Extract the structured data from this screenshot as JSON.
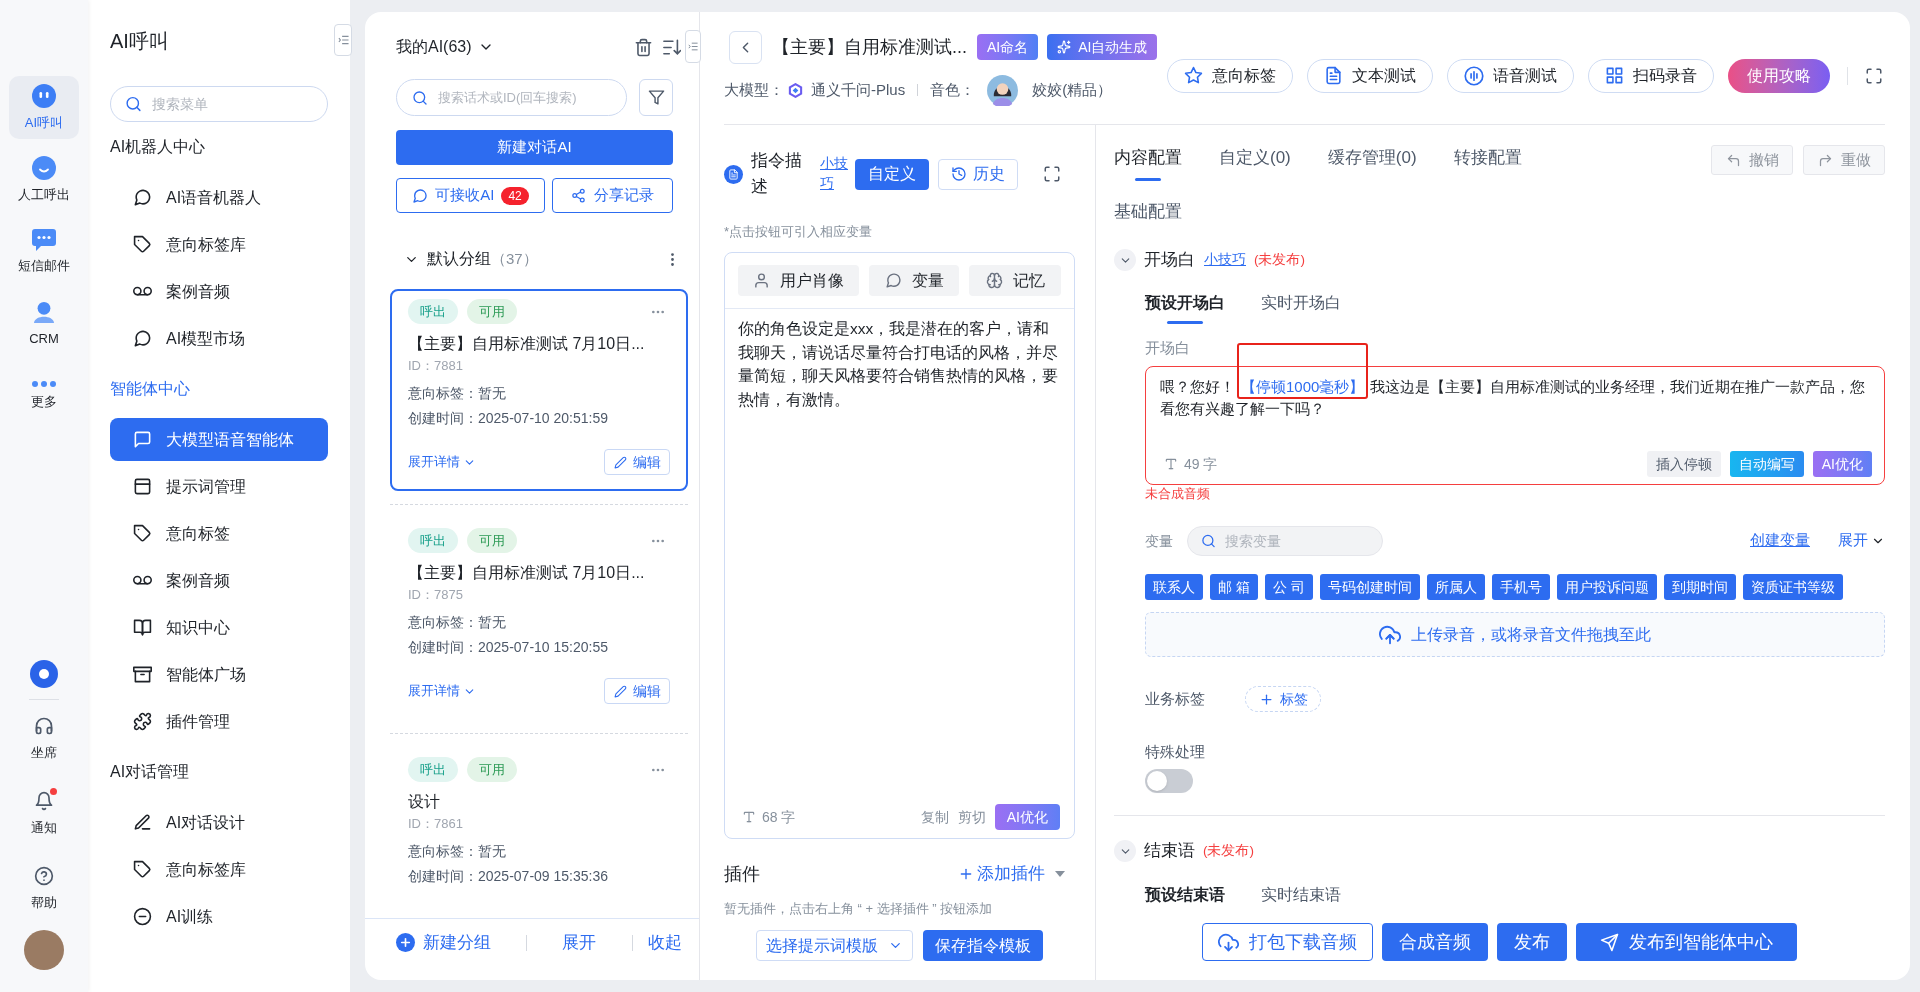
{
  "rail": {
    "items": [
      {
        "label": "AI呼叫",
        "selected": true
      },
      {
        "label": "人工呼出",
        "selected": false
      },
      {
        "label": "短信邮件",
        "selected": false
      },
      {
        "label": "CRM",
        "selected": false
      },
      {
        "label": "更多",
        "selected": false
      }
    ],
    "tools": [
      {
        "label": "坐席",
        "badge": false
      },
      {
        "label": "通知",
        "badge": true
      },
      {
        "label": "帮助",
        "badge": false
      }
    ]
  },
  "sidebar": {
    "title": "AI呼叫",
    "search": {
      "placeholder": "搜索菜单"
    },
    "sections": [
      {
        "heading": "AI机器人中心",
        "active": false,
        "items": [
          {
            "label": "AI语音机器人",
            "selected": false
          },
          {
            "label": "意向标签库",
            "selected": false
          },
          {
            "label": "案例音频",
            "selected": false
          },
          {
            "label": "AI模型市场",
            "selected": false
          }
        ]
      },
      {
        "heading": "智能体中心",
        "active": true,
        "items": [
          {
            "label": "大模型语音智能体",
            "selected": true
          },
          {
            "label": "提示词管理",
            "selected": false
          },
          {
            "label": "意向标签",
            "selected": false
          },
          {
            "label": "案例音频",
            "selected": false
          },
          {
            "label": "知识中心",
            "selected": false
          },
          {
            "label": "智能体广场",
            "selected": false
          },
          {
            "label": "插件管理",
            "selected": false
          }
        ]
      },
      {
        "heading": "AI对话管理",
        "active": false,
        "items": [
          {
            "label": "AI对话设计",
            "selected": false
          },
          {
            "label": "意向标签库",
            "selected": false
          },
          {
            "label": "AI训练",
            "selected": false
          }
        ]
      }
    ]
  },
  "agents": {
    "title": "我的AI(63)",
    "search": {
      "placeholder": "搜索话术或ID(回车搜索)"
    },
    "new_button": "新建对话AI",
    "receive_button": {
      "label": "可接收AI",
      "count": "42"
    },
    "share_button": "分享记录",
    "group": {
      "name": "默认分组",
      "count": "（37）",
      "expanded": true
    },
    "cards": [
      {
        "selected": true,
        "tags": [
          {
            "label": "呼出",
            "kind": "direction"
          },
          {
            "label": "可用",
            "kind": "status"
          }
        ],
        "title": "【主要】自用标准测试 7月10日...",
        "id": "ID：7881",
        "intent": "意向标签：暂无",
        "created": "创建时间：2025-07-10 20:51:59",
        "expand_link": "展开详情",
        "edit_button": "编辑"
      },
      {
        "selected": false,
        "tags": [
          {
            "label": "呼出",
            "kind": "direction"
          },
          {
            "label": "可用",
            "kind": "status"
          }
        ],
        "title": "【主要】自用标准测试 7月10日...",
        "id": "ID：7875",
        "intent": "意向标签：暂无",
        "created": "创建时间：2025-07-10 15:20:55",
        "expand_link": "展开详情",
        "edit_button": "编辑"
      },
      {
        "selected": false,
        "tags": [
          {
            "label": "呼出",
            "kind": "direction"
          },
          {
            "label": "可用",
            "kind": "status"
          }
        ],
        "title": "设计",
        "id": "ID：7861",
        "intent": "意向标签：暂无",
        "created": "创建时间：2025-07-09 15:35:36"
      }
    ],
    "footer": {
      "new_group": "新建分组",
      "expand": "展开",
      "collapse": "收起"
    }
  },
  "header": {
    "title": "【主要】自用标准测试...",
    "name_button": "AI命名",
    "generate_button": "AI自动生成",
    "model_label": "大模型：",
    "model": "通义千问-Plus",
    "voice_label": "音色：",
    "voice": "姣姣(精品）",
    "actions": [
      "意向标签",
      "文本测试",
      "语音测试",
      "扫码录音"
    ],
    "guide_button": "使用攻略"
  },
  "instruction": {
    "title": "指令描述",
    "tips_link": "小技巧",
    "custom_button": "自定义",
    "history_button": "历史",
    "hint": "*点击按钮可引入相应变量",
    "inserts": [
      "用户肖像",
      "变量",
      "记忆"
    ],
    "text": "你的角色设定是xxx，我是潜在的客户，请和我聊天，请说话尽量符合打电话的风格，并尽量简短，聊天风格要符合销售热情的风格，要热情，有激情。",
    "char_count": "68 字",
    "copy": "复制",
    "cut": "剪切",
    "optimize_button": "AI优化"
  },
  "plugins": {
    "title": "插件",
    "add_button": "添加插件",
    "empty": "暂无插件，点击右上角 “ + 选择插件 ” 按钮添加",
    "template_select": "选择提示词模版",
    "save_button": "保存指令模板"
  },
  "config": {
    "tabs": [
      {
        "label": "内容配置",
        "selected": true
      },
      {
        "label": "自定义(0)",
        "selected": false
      },
      {
        "label": "缓存管理(0)",
        "selected": false
      },
      {
        "label": "转接配置",
        "selected": false
      }
    ],
    "undo_button": {
      "label": "撤销",
      "disabled": true
    },
    "redo_button": {
      "label": "重做",
      "disabled": true
    },
    "section_title": "基础配置",
    "opening": {
      "title": "开场白",
      "tips_link": "小技巧",
      "status": "(未发布)",
      "expanded": true,
      "subtabs": [
        {
          "label": "预设开场白",
          "selected": true
        },
        {
          "label": "实时开场白",
          "selected": false
        }
      ],
      "field_label": "开场白",
      "content": [
        {
          "kind": "text",
          "text": "喂？您好！"
        },
        {
          "kind": "pause",
          "text": "【停顿1000毫秒】"
        },
        {
          "kind": "text",
          "text": "我这边是【主要】自用标准测试的业务经理，我们近期在推广一款产品，您看您有兴趣了解一下吗？"
        }
      ],
      "annotation_box": true,
      "char_count": "49 字",
      "buttons": [
        {
          "label": "插入停顿",
          "kind": "plain"
        },
        {
          "label": "自动编写",
          "kind": "auto"
        },
        {
          "label": "AI优化",
          "kind": "ai"
        }
      ],
      "error": "未合成音频"
    },
    "variables": {
      "label": "变量",
      "search": {
        "placeholder": "搜索变量"
      },
      "create_link": "创建变量",
      "expand_link": "展开",
      "chips": [
        "联系人",
        "邮 箱",
        "公 司",
        "号码创建时间",
        "所属人",
        "手机号",
        "用户投诉问题",
        "到期时间",
        "资质证书等级"
      ]
    },
    "upload": "上传录音，或将录音文件拖拽至此",
    "business_tags": {
      "label": "业务标签",
      "add_button": "标签"
    },
    "special": {
      "label": "特殊处理",
      "on": false
    },
    "closing": {
      "title": "结束语",
      "status": "(未发布)",
      "expanded": true,
      "subtabs": [
        {
          "label": "预设结束语",
          "selected": true
        },
        {
          "label": "实时结束语",
          "selected": false
        }
      ]
    }
  },
  "actions": [
    {
      "label": "打包下载音频",
      "kind": "download"
    },
    {
      "label": "合成音频",
      "kind": "primary"
    },
    {
      "label": "发布",
      "kind": "primary"
    },
    {
      "label": "发布到智能体中心",
      "kind": "send"
    }
  ]
}
